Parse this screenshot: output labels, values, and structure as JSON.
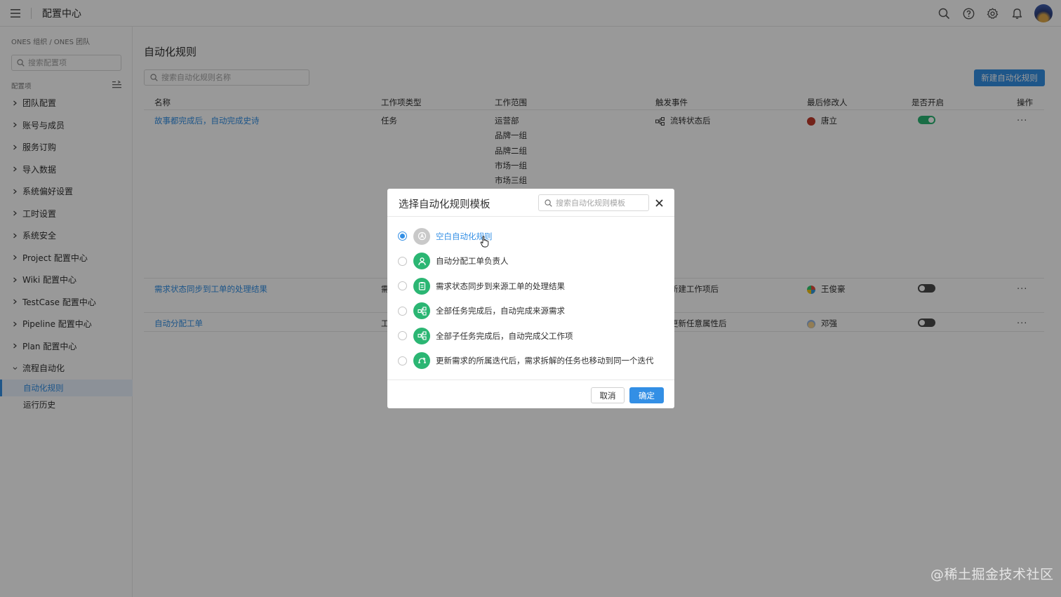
{
  "topbar": {
    "title": "配置中心",
    "icons": [
      "menu-icon",
      "search-icon",
      "help-icon",
      "gear-icon",
      "bell-icon",
      "avatar"
    ]
  },
  "sidebar": {
    "breadcrumb": "ONES 组织 / ONES 团队",
    "search_placeholder": "搜索配置项",
    "section_label": "配置项",
    "items": [
      {
        "label": "团队配置"
      },
      {
        "label": "账号与成员"
      },
      {
        "label": "服务订购"
      },
      {
        "label": "导入数据"
      },
      {
        "label": "系统偏好设置"
      },
      {
        "label": "工时设置"
      },
      {
        "label": "系统安全"
      },
      {
        "label": "Project 配置中心"
      },
      {
        "label": "Wiki 配置中心"
      },
      {
        "label": "TestCase 配置中心"
      },
      {
        "label": "Pipeline 配置中心"
      },
      {
        "label": "Plan 配置中心"
      },
      {
        "label": "流程自动化"
      }
    ],
    "sub_items": [
      {
        "label": "自动化规则"
      },
      {
        "label": "运行历史"
      }
    ]
  },
  "main": {
    "title": "自动化规则",
    "search_placeholder": "搜索自动化规则名称",
    "new_button": "新建自动化规则",
    "columns": [
      "名称",
      "工作项类型",
      "工作范围",
      "触发事件",
      "最后修改人",
      "是否开启",
      "操作"
    ],
    "rows": [
      {
        "name": "故事都完成后，自动完成史诗",
        "type": "任务",
        "scope": [
          "运营部",
          "品牌一组",
          "品牌二组",
          "市场一组",
          "市场三组"
        ],
        "trigger": "流转状态后",
        "modifier": "唐立",
        "enabled": true,
        "action": "···"
      },
      {
        "name": "需求状态同步到工单的处理结果",
        "type": "需",
        "scope": [],
        "trigger": "新建工作项后",
        "modifier": "王俊豪",
        "enabled": false,
        "action": "···"
      },
      {
        "name": "自动分配工单",
        "type": "工",
        "scope": [],
        "trigger": "更新任意属性后",
        "modifier": "邓强",
        "enabled": false,
        "action": "···"
      }
    ]
  },
  "modal": {
    "title": "选择自动化规则模板",
    "search_placeholder": "搜索自动化规则模板",
    "options": [
      {
        "label": "空白自动化规则",
        "selected": true,
        "icon": "blank-rule-icon"
      },
      {
        "label": "自动分配工单负责人",
        "selected": false,
        "icon": "person-icon"
      },
      {
        "label": "需求状态同步到来源工单的处理结果",
        "selected": false,
        "icon": "clipboard-icon"
      },
      {
        "label": "全部任务完成后，自动完成来源需求",
        "selected": false,
        "icon": "flow-icon"
      },
      {
        "label": "全部子任务完成后，自动完成父工作项",
        "selected": false,
        "icon": "flow-icon"
      },
      {
        "label": "更新需求的所属迭代后，需求拆解的任务也移动到同一个迭代",
        "selected": false,
        "icon": "iteration-icon"
      }
    ],
    "cancel": "取消",
    "ok": "确定"
  },
  "watermark": "@稀土掘金技术社区",
  "colors": {
    "accent": "#338fe5",
    "success": "#2bb673"
  }
}
